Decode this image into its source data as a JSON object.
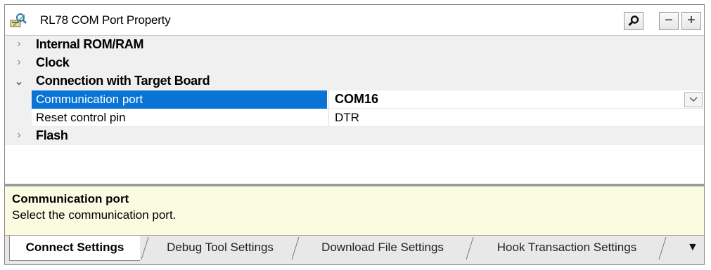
{
  "window": {
    "title": "RL78 COM Port Property",
    "buttons": {
      "search": "⚲",
      "minus": "−",
      "plus": "+"
    }
  },
  "grid": {
    "categories": [
      {
        "label": "Internal ROM/RAM",
        "expanded": false,
        "chevron": "›"
      },
      {
        "label": "Clock",
        "expanded": false,
        "chevron": "›"
      },
      {
        "label": "Connection with Target Board",
        "expanded": true,
        "chevron": "⌄"
      },
      {
        "label": "Flash",
        "expanded": false,
        "chevron": "›"
      }
    ],
    "properties": [
      {
        "name": "Communication port",
        "value": "COM16",
        "selected": true
      },
      {
        "name": "Reset control pin",
        "value": "DTR",
        "selected": false
      }
    ],
    "dropdown_glyph": "⌵"
  },
  "description": {
    "title": "Communication port",
    "text": "Select the communication port."
  },
  "tabs": [
    {
      "label": "Connect Settings",
      "active": true
    },
    {
      "label": "Debug Tool Settings",
      "active": false
    },
    {
      "label": "Download File Settings",
      "active": false
    },
    {
      "label": "Hook Transaction Settings",
      "active": false
    }
  ],
  "tab_overflow_glyph": "▼",
  "colors": {
    "selection": "#0a74d6",
    "description_bg": "#fbfbe2",
    "category_bg": "#f0f0f0"
  }
}
